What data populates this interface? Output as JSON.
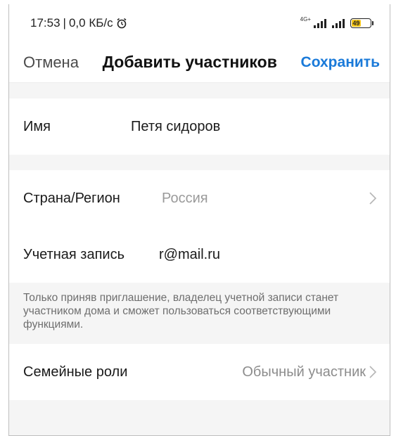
{
  "status_bar": {
    "time": "17:53",
    "separator": "|",
    "speed": "0,0 КБ/с",
    "network_label": "4G+",
    "battery_level": "49",
    "icons": [
      "alarm-icon",
      "signal-4g-icon",
      "signal-icon",
      "battery-icon"
    ]
  },
  "nav": {
    "cancel_label": "Отмена",
    "title": "Добавить участников",
    "save_label": "Сохранить",
    "accent_color": "#1a7ad9"
  },
  "form": {
    "name": {
      "label": "Имя",
      "value": "Петя сидоров"
    },
    "region": {
      "label": "Страна/Регион",
      "value": "Россия"
    },
    "account": {
      "label": "Учетная запись",
      "value": "r@mail.ru"
    },
    "hint": "Только приняв приглашение, владелец учетной записи станет участником дома и сможет пользоваться соответствующими функциями.",
    "roles": {
      "label": "Семейные роли",
      "value": "Обычный участник"
    }
  }
}
